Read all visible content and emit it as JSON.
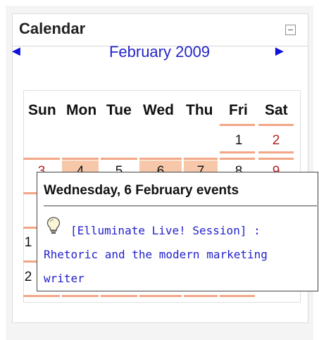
{
  "block": {
    "title": "Calendar"
  },
  "calendar": {
    "month": "February 2009",
    "prev_arrow": "◄",
    "next_arrow": "►",
    "weekdays": [
      "Sun",
      "Mon",
      "Tue",
      "Wed",
      "Thu",
      "Fri",
      "Sat"
    ],
    "visible_days": {
      "d1": "1",
      "d2": "2",
      "d3": "3",
      "d4": "4",
      "d5": "5",
      "d6": "6",
      "d7": "7",
      "d8": "8",
      "d9": "9",
      "d15": "1",
      "d22": "2"
    }
  },
  "popup": {
    "title": "Wednesday, 6 February events",
    "event": "[Elluminate Live! Session] : Rhetoric and the modern marketing writer"
  },
  "colors": {
    "link": "#1f1fcc",
    "weekend_day": "#b22222",
    "event_underline": "#f2a685",
    "today_bg": "#f7c7aa"
  }
}
